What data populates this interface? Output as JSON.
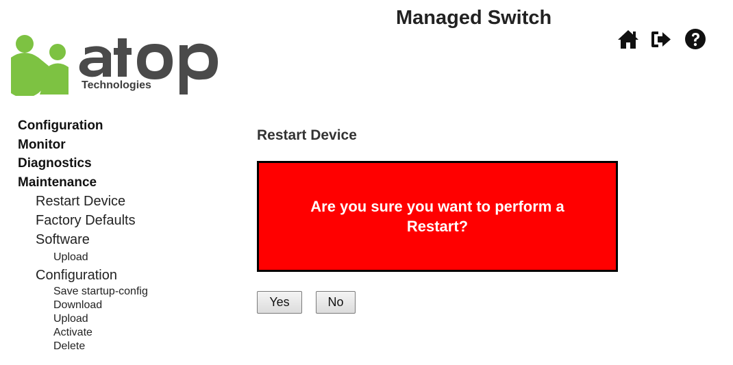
{
  "header": {
    "logo_text": "atop",
    "logo_subtitle": "Technologies",
    "title": "Managed Switch",
    "icons": [
      "home-icon",
      "logout-icon",
      "help-icon"
    ]
  },
  "sidebar": {
    "top": [
      {
        "label": "Configuration"
      },
      {
        "label": "Monitor"
      },
      {
        "label": "Diagnostics"
      },
      {
        "label": "Maintenance"
      }
    ],
    "maintenance": {
      "restart_device": "Restart Device",
      "factory_defaults": "Factory Defaults",
      "software": "Software",
      "software_upload": "Upload",
      "configuration": "Configuration",
      "config_items": [
        {
          "label": "Save startup-config"
        },
        {
          "label": "Download"
        },
        {
          "label": "Upload"
        },
        {
          "label": "Activate"
        },
        {
          "label": "Delete"
        }
      ]
    }
  },
  "main": {
    "heading": "Restart Device",
    "alert_text": "Are you sure you want to perform a Restart?",
    "yes_label": "Yes",
    "no_label": "No"
  },
  "colors": {
    "logo_green": "#7dc242",
    "logo_grey": "#4a4a4a",
    "alert_bg": "#ff0000",
    "alert_border": "#000000"
  }
}
